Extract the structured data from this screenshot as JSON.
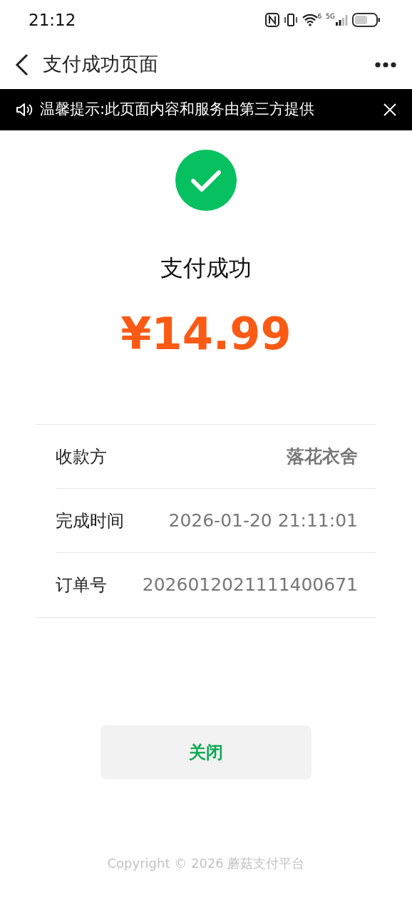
{
  "status_bar": {
    "time": "21:12",
    "wifi_badge": "6",
    "network": "5G"
  },
  "nav": {
    "title": "支付成功页面"
  },
  "notice": {
    "text": "温馨提示:此页面内容和服务由第三方提供"
  },
  "result": {
    "title": "支付成功",
    "amount": "¥14.99"
  },
  "details": [
    {
      "label": "收款方",
      "value": "落花衣舍",
      "emphasis": true
    },
    {
      "label": "完成时间",
      "value": "2026-01-20 21:11:01",
      "emphasis": false
    },
    {
      "label": "订单号",
      "value": "2026012021111400671",
      "emphasis": false
    }
  ],
  "close_button": "关闭",
  "footer": "Copyright © 2026 蘑菇支付平台"
}
